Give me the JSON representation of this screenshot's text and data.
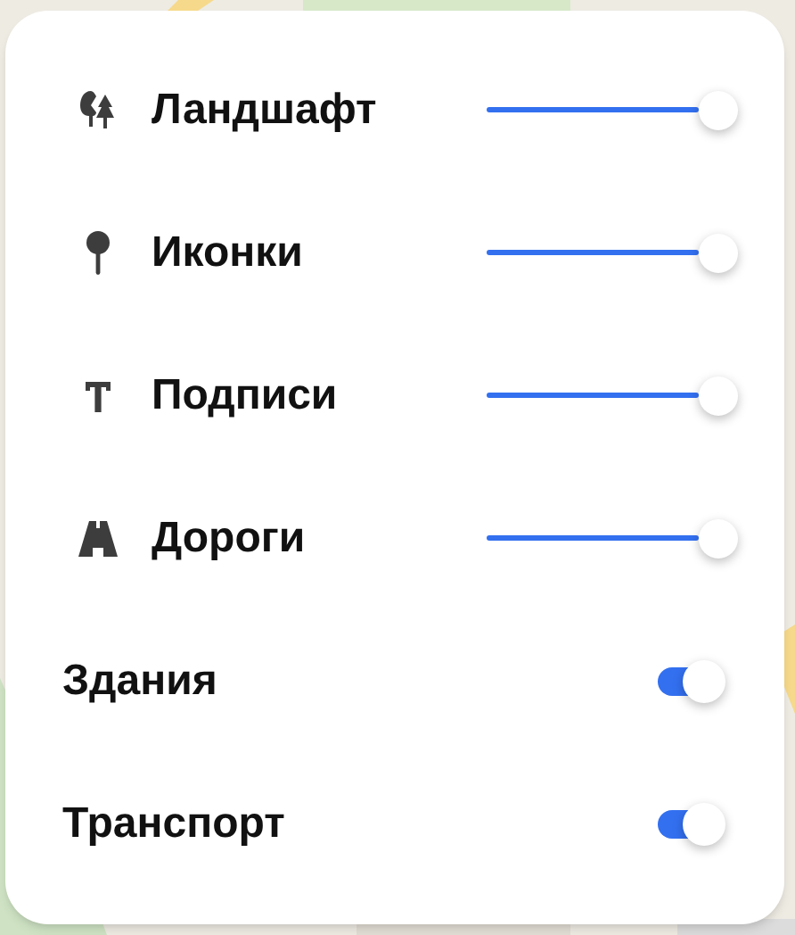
{
  "layers": [
    {
      "kind": "slider",
      "label": "Ландшафт",
      "level": 1
    },
    {
      "kind": "slider",
      "label": "Иконки",
      "level": 1
    },
    {
      "kind": "slider",
      "label": "Подписи",
      "level": 1
    },
    {
      "kind": "slider",
      "label": "Дороги",
      "level": 1
    },
    {
      "kind": "toggle",
      "label": "Здания",
      "on": true
    },
    {
      "kind": "toggle",
      "label": "Транспорт",
      "on": true
    }
  ]
}
